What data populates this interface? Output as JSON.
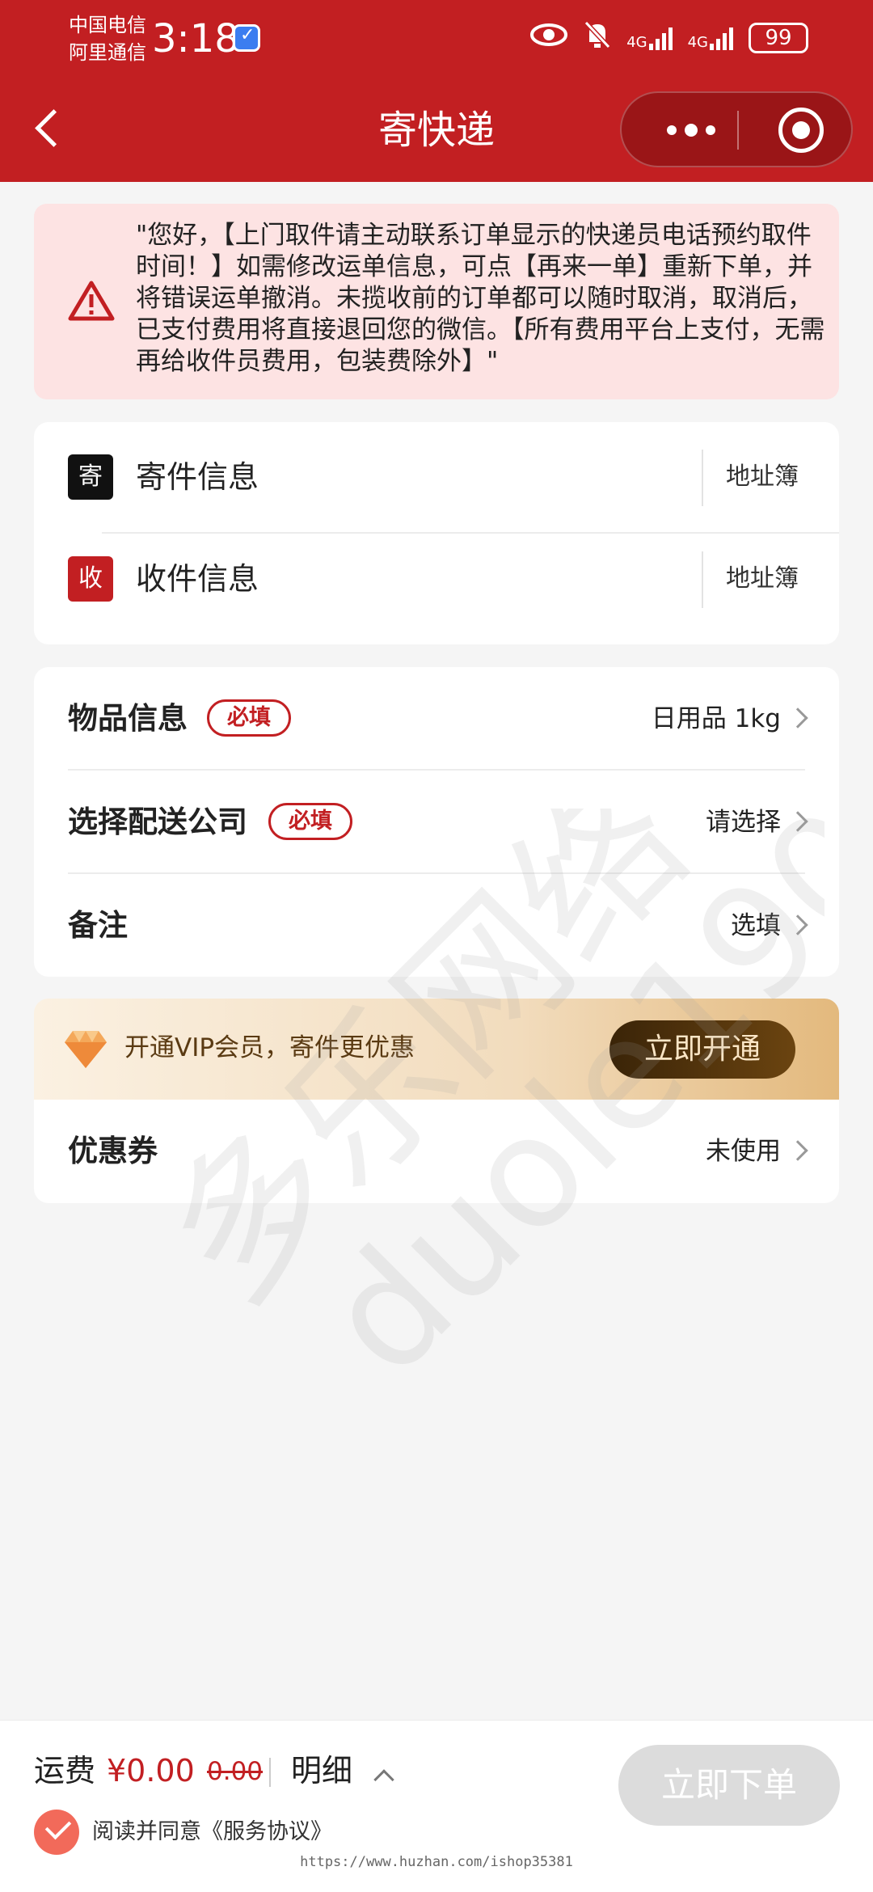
{
  "status_bar": {
    "carrier_1": "中国电信",
    "carrier_2": "阿里通信",
    "time": "3:18",
    "signal_1": "4G",
    "signal_2": "4G",
    "battery": "99"
  },
  "header": {
    "title": "寄快递"
  },
  "notice": {
    "text": "\"您好，【上门取件请主动联系订单显示的快递员电话预约取件时间！】如需修改运单信息，可点【再来一单】重新下单，并将错误运单撤消。未揽收前的订单都可以随时取消，取消后，已支付费用将直接退回您的微信。【所有费用平台上支付，无需再给收件员费用，包装费除外】\""
  },
  "address": {
    "sender": {
      "badge": "寄",
      "label": "寄件信息",
      "book": "地址簿"
    },
    "receiver": {
      "badge": "收",
      "label": "收件信息",
      "book": "地址簿"
    }
  },
  "goods": {
    "item": {
      "label": "物品信息",
      "tag": "必填",
      "value": "日用品 1kg"
    },
    "courier": {
      "label": "选择配送公司",
      "tag": "必填",
      "value": "请选择"
    },
    "remark": {
      "label": "备注",
      "value": "选填"
    }
  },
  "vip": {
    "text": "开通VIP会员，寄件更优惠",
    "button": "立即开通"
  },
  "coupon": {
    "label": "优惠券",
    "value": "未使用"
  },
  "watermark": {
    "line1": "多乐网络",
    "line2": "duole190"
  },
  "bottom": {
    "fee_label": "运费",
    "fee_value": "¥0.00",
    "fee_original": "0.00",
    "detail": "明细",
    "submit": "立即下单",
    "agree_text": "阅读并同意",
    "agree_link": "《服务协议》",
    "footer_url": "https://www.huzhan.com/ishop35381"
  },
  "colors": {
    "brand_red": "#c21f22",
    "accent_coral": "#f26a5a",
    "vip_gold": "#e3b97d"
  }
}
